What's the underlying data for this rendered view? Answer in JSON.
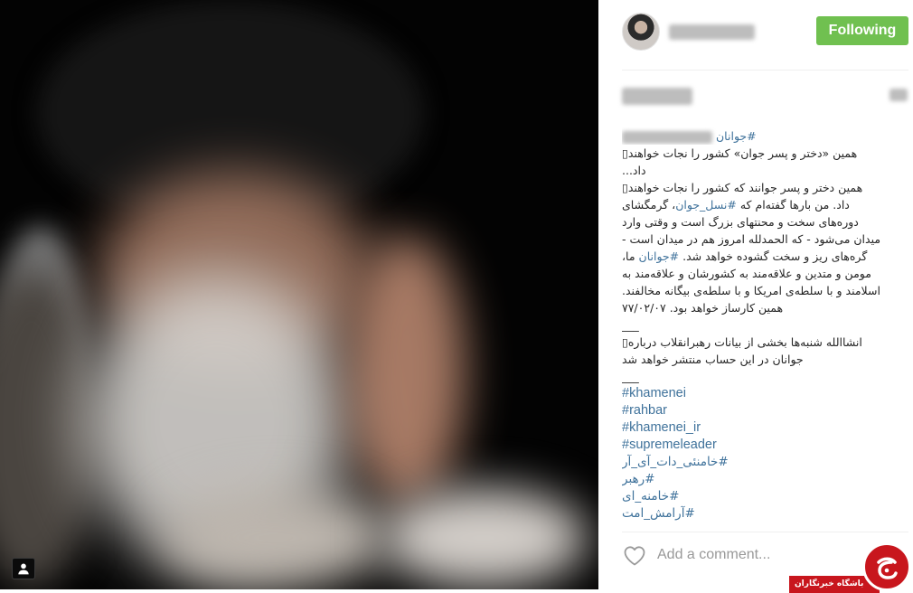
{
  "post": {
    "follow_button_label": "Following"
  },
  "caption": {
    "opening_hashtag": "#جوانان",
    "lines": [
      [
        {
          "text": "همین «دختر و پسر جوان» کشور را نجات خواهند▯"
        }
      ],
      [
        {
          "text": "داد..."
        }
      ],
      [
        {
          "text": "همین دختر و پسر جوانند که کشور را نجات خواهند▯"
        }
      ],
      [
        {
          "text": "داد. من بارها گفته‌ام که "
        },
        {
          "text": "#نسل_جوان",
          "link": true
        },
        {
          "text": "، گرمگشای"
        }
      ],
      [
        {
          "text": "دوره‌های سخت و محنتهای بزرگ است و وقتی وارد"
        }
      ],
      [
        {
          "text": "میدان می‌شود - که الحمدلله امروز هم در میدان است -"
        }
      ],
      [
        {
          "text": "گره‌های ریز و سخت گشوده خواهد شد. "
        },
        {
          "text": "#جوانان",
          "link": true
        },
        {
          "text": " ما،"
        }
      ],
      [
        {
          "text": "مومن و متدین و علاقه‌مند به کشورشان و علاقه‌مند به"
        }
      ],
      [
        {
          "text": "اسلامند و با سلطه‌ی امریکا و با سلطه‌ی بیگانه مخالفند."
        }
      ],
      [
        {
          "text": "همین کارساز خواهد بود. ۷۷/۰۲/۰۷"
        }
      ],
      [
        {
          "text": "___"
        }
      ],
      [
        {
          "text": "انشاالله شنبه‌ها بخشی از بیانات رهبرانقلاب درباره▯"
        }
      ],
      [
        {
          "text": "جوانان در این حساب منتشر خواهد شد"
        }
      ],
      [
        {
          "text": "___"
        }
      ],
      [
        {
          "text": "#khamenei",
          "link": true
        }
      ],
      [
        {
          "text": "#rahbar",
          "link": true
        }
      ],
      [
        {
          "text": "#khamenei_ir",
          "link": true
        }
      ],
      [
        {
          "text": "#supremeleader",
          "link": true
        }
      ],
      [
        {
          "text": "#خامنئی_دات_آی_آر",
          "link": true
        }
      ],
      [
        {
          "text": "#رهبر",
          "link": true
        }
      ],
      [
        {
          "text": "#خامنه_ای",
          "link": true
        }
      ],
      [
        {
          "text": "#آرامش_امت",
          "link": true
        }
      ]
    ]
  },
  "comment": {
    "placeholder": "Add a comment..."
  },
  "watermark": {
    "text": "باشگاه خبرنگاران"
  },
  "icons": {
    "photo_user_tag": "user-tag-icon",
    "like": "heart-icon",
    "watermark_logo": "news-agency-logo-icon"
  },
  "colors": {
    "follow_button": "#70c050",
    "hashtag_link": "#3f729b",
    "caption_text": "#262626",
    "comment_placeholder": "#999999",
    "watermark_red": "#c8161d"
  }
}
